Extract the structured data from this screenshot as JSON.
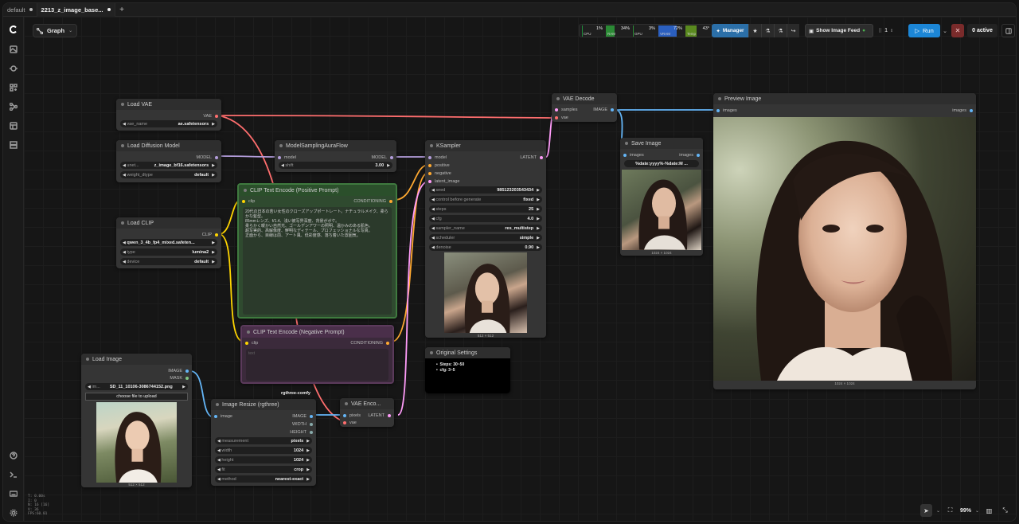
{
  "tabs": [
    {
      "label": "default",
      "active": false
    },
    {
      "label": "2213_z_image_base...",
      "active": true
    }
  ],
  "toolbar": {
    "graph_label": "Graph",
    "monitors": [
      {
        "name": "CPU",
        "value": "1%",
        "color": "#1f8a3a"
      },
      {
        "name": "RAM",
        "value": "34%",
        "color": "#2b8a35"
      },
      {
        "name": "GPU",
        "value": "3%",
        "color": "#2b8a35"
      },
      {
        "name": "VRAM",
        "value": "72%",
        "color": "#2b5fbf"
      },
      {
        "name": "Temp",
        "value": "43°",
        "color": "#5a8a1f"
      }
    ],
    "manager_label": "Manager",
    "feed_label": "Show Image Feed",
    "queue_count": "1",
    "run_label": "Run",
    "active_label": "0 active"
  },
  "nodes": {
    "load_vae": {
      "title": "Load VAE",
      "output": "VAE",
      "widget": {
        "name": "vae_name",
        "value": "ae.safetensors"
      }
    },
    "load_diffusion": {
      "title": "Load Diffusion Model",
      "output": "MODEL",
      "widgets": [
        {
          "name": "unet...",
          "value": "z_image_bf16.safetensors"
        },
        {
          "name": "weight_dtype",
          "value": "default"
        }
      ]
    },
    "model_sampling": {
      "title": "ModelSamplingAuraFlow",
      "input": "model",
      "output": "MODEL",
      "widget": {
        "name": "shift",
        "value": "3.00"
      }
    },
    "load_clip": {
      "title": "Load CLIP",
      "output": "CLIP",
      "widgets": [
        {
          "name": "",
          "value": "qwen_3_4b_fp4_mixed.safeten..."
        },
        {
          "name": "type",
          "value": "lumina2"
        },
        {
          "name": "device",
          "value": "default"
        }
      ]
    },
    "clip_pos": {
      "title": "CLIP Text Encode (Positive Prompt)",
      "input": "clip",
      "output": "CONDITIONING",
      "text": "20代の日本の若い女性のクローズアップポートレート。ナチュラルメイク、柔らかな髪型。\n85mmレンズ、f/1.4、浅い被写界深度、背景がボケ。\n柔らかく暖かい自然光、ゴールデンアワーの照明、温かみのある肌色。\n超写実的、高解像度、鮮明なディテール、プロフェッショナルな写真。\n正面から、目線は前、アート風、低彩度感、落ち着いた雰囲気。"
    },
    "clip_neg": {
      "title": "CLIP Text Encode (Negative Prompt)",
      "input": "clip",
      "output": "CONDITIONING",
      "text": "text"
    },
    "ksampler": {
      "title": "KSampler",
      "inputs": [
        "model",
        "positive",
        "negative",
        "latent_image"
      ],
      "output": "LATENT",
      "widgets": [
        {
          "name": "seed",
          "value": "985123203543434"
        },
        {
          "name": "control before generate",
          "value": "fixed"
        },
        {
          "name": "steps",
          "value": "25"
        },
        {
          "name": "cfg",
          "value": "4.0"
        },
        {
          "name": "sampler_name",
          "value": "res_multistep"
        },
        {
          "name": "scheduler",
          "value": "simple"
        },
        {
          "name": "denoise",
          "value": "0.90"
        }
      ],
      "caption": "512 × 512"
    },
    "vae_decode": {
      "title": "VAE Decode",
      "inputs": [
        "samples",
        "vae"
      ],
      "output": "IMAGE"
    },
    "save_image": {
      "title": "Save Image",
      "input": "images",
      "output": "images",
      "widget": "%date:yyyy%-%date:M ...",
      "caption": "1024 × 1024"
    },
    "preview_image": {
      "title": "Preview Image",
      "input": "images",
      "output": "images",
      "caption": "1024 × 1024"
    },
    "original_settings": {
      "title": "Original Settings",
      "items": [
        "Steps: 30~50",
        "cfg: 3~5"
      ]
    },
    "load_image": {
      "title": "Load Image",
      "outputs": [
        "IMAGE",
        "MASK"
      ],
      "widget": {
        "name": "im...",
        "value": "SD_11_10106-3086744152.png"
      },
      "upload_label": "choose file to upload",
      "caption": "512 × 512"
    },
    "image_resize": {
      "group_label": "rgthree-comfy",
      "title": "Image Resize (rgthree)",
      "input": "image",
      "outputs": [
        "IMAGE",
        "WIDTH",
        "HEIGHT"
      ],
      "widgets": [
        {
          "name": "measurement",
          "value": "pixels"
        },
        {
          "name": "width",
          "value": "1024"
        },
        {
          "name": "height",
          "value": "1024"
        },
        {
          "name": "fit",
          "value": "crop"
        },
        {
          "name": "method",
          "value": "nearest-exact"
        }
      ]
    },
    "vae_encode": {
      "title": "VAE Enco...",
      "inputs": [
        "pixels",
        "vae"
      ],
      "output": "LATENT"
    }
  },
  "bottom": {
    "zoom": "99%"
  },
  "stats": [
    "T: 0.00s",
    "I: 0",
    "N: 16 [16]",
    "V: 36",
    "FPS:60.01"
  ],
  "colors": {
    "vae": "#ff6e6e",
    "model": "#b39ddb",
    "clip": "#ffd500",
    "conditioning": "#ffa931",
    "latent": "#ff9cf9",
    "image": "#64b5f6",
    "mask": "#81c784"
  }
}
